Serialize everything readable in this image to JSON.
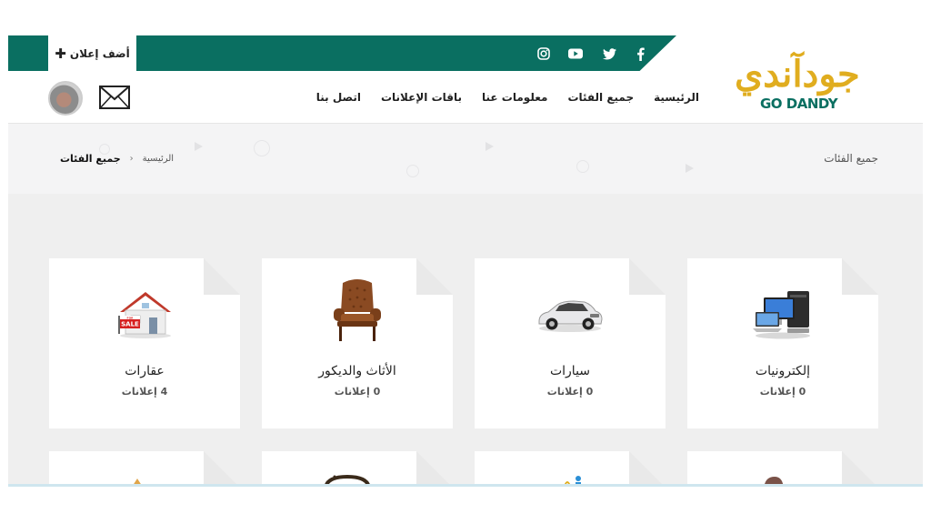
{
  "topbar": {
    "add_ad_label": "أضف إعلان",
    "add_ad_icon": "plus-icon",
    "social": [
      "facebook-icon",
      "twitter-icon",
      "youtube-icon",
      "instagram-icon"
    ],
    "colors": {
      "brand_green": "#0a6f61",
      "brand_yellow": "#e0ad1f"
    }
  },
  "logo": {
    "arabic": "جودآندي",
    "english": "GO DANDY"
  },
  "nav": {
    "items": [
      "الرئيسية",
      "جميع الفئات",
      "معلومات عنا",
      "باقات الإعلانات",
      "اتصل بنا"
    ]
  },
  "header_icons": {
    "mail": "envelope-icon",
    "avatar": "user-avatar"
  },
  "breadcrumb": {
    "home": "الرئيسية",
    "separator": "›",
    "current": "جميع الفئات",
    "page_title": "جميع الفئات"
  },
  "categories": [
    {
      "name": "إلكترونيات",
      "count": "0 إعلانات",
      "icon": "computer-icon"
    },
    {
      "name": "سيارات",
      "count": "0 إعلانات",
      "icon": "car-icon"
    },
    {
      "name": "الأثاث والديكور",
      "count": "0 إعلانات",
      "icon": "armchair-icon"
    },
    {
      "name": "عقارات",
      "count": "4 إعلانات",
      "icon": "house-for-sale-icon"
    }
  ],
  "house_sign": "FOR SALE"
}
